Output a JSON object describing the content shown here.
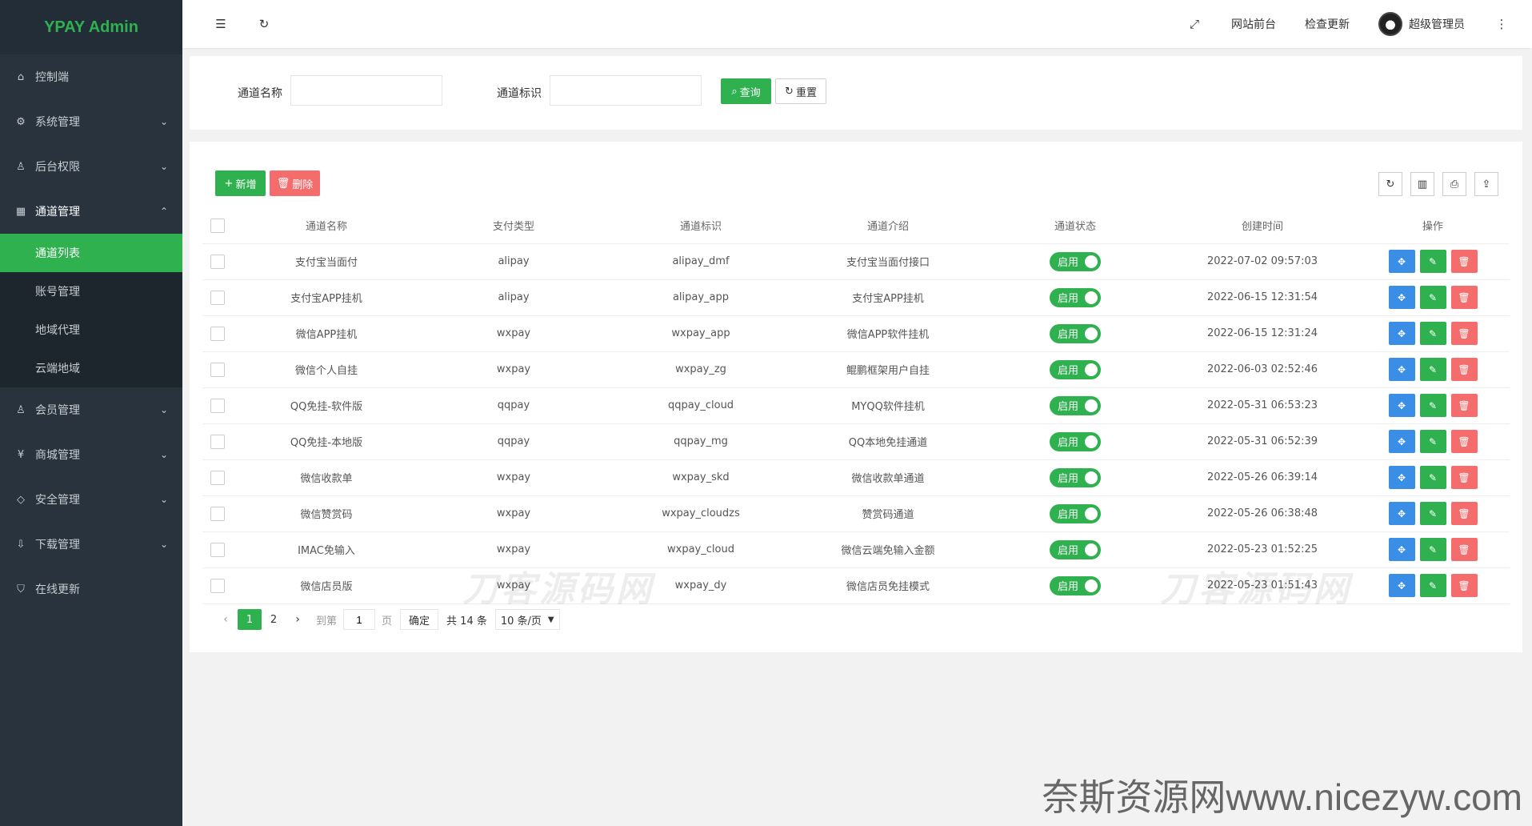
{
  "app": {
    "title": "YPAY Admin"
  },
  "sidebar": {
    "items": [
      {
        "label": "控制端",
        "icon": "home-icon"
      },
      {
        "label": "系统管理",
        "icon": "gear-icon"
      },
      {
        "label": "后台权限",
        "icon": "user-icon"
      },
      {
        "label": "通道管理",
        "icon": "apps-icon"
      },
      {
        "label": "会员管理",
        "icon": "user-icon"
      },
      {
        "label": "商城管理",
        "icon": "yen-icon"
      },
      {
        "label": "安全管理",
        "icon": "diamond-icon"
      },
      {
        "label": "下载管理",
        "icon": "download-icon"
      },
      {
        "label": "在线更新",
        "icon": "shield-check-icon"
      }
    ],
    "submenu": [
      "通道列表",
      "账号管理",
      "地域代理",
      "云端地域"
    ]
  },
  "header": {
    "site_front": "网站前台",
    "check_update": "检查更新",
    "user_name": "超级管理员"
  },
  "search": {
    "channel_name_label": "通道名称",
    "channel_name_value": "",
    "channel_id_label": "通道标识",
    "channel_id_value": "",
    "query_label": "查询",
    "reset_label": "重置"
  },
  "toolbar": {
    "add_label": "新增",
    "delete_label": "删除"
  },
  "table": {
    "columns": [
      "通道名称",
      "支付类型",
      "通道标识",
      "通道介绍",
      "通道状态",
      "创建时间",
      "操作"
    ],
    "rows": [
      {
        "name": "支付宝当面付",
        "pay_type": "alipay",
        "code": "alipay_dmf",
        "intro": "支付宝当面付接口",
        "status": "启用",
        "created": "2022-07-02 09:57:03"
      },
      {
        "name": "支付宝APP挂机",
        "pay_type": "alipay",
        "code": "alipay_app",
        "intro": "支付宝APP挂机",
        "status": "启用",
        "created": "2022-06-15 12:31:54"
      },
      {
        "name": "微信APP挂机",
        "pay_type": "wxpay",
        "code": "wxpay_app",
        "intro": "微信APP软件挂机",
        "status": "启用",
        "created": "2022-06-15 12:31:24"
      },
      {
        "name": "微信个人自挂",
        "pay_type": "wxpay",
        "code": "wxpay_zg",
        "intro": "鲲鹏框架用户自挂",
        "status": "启用",
        "created": "2022-06-03 02:52:46"
      },
      {
        "name": "QQ免挂-软件版",
        "pay_type": "qqpay",
        "code": "qqpay_cloud",
        "intro": "MYQQ软件挂机",
        "status": "启用",
        "created": "2022-05-31 06:53:23"
      },
      {
        "name": "QQ免挂-本地版",
        "pay_type": "qqpay",
        "code": "qqpay_mg",
        "intro": "QQ本地免挂通道",
        "status": "启用",
        "created": "2022-05-31 06:52:39"
      },
      {
        "name": "微信收款单",
        "pay_type": "wxpay",
        "code": "wxpay_skd",
        "intro": "微信收款单通道",
        "status": "启用",
        "created": "2022-05-26 06:39:14"
      },
      {
        "name": "微信赞赏码",
        "pay_type": "wxpay",
        "code": "wxpay_cloudzs",
        "intro": "赞赏码通道",
        "status": "启用",
        "created": "2022-05-26 06:38:48"
      },
      {
        "name": "IMAC免输入",
        "pay_type": "wxpay",
        "code": "wxpay_cloud",
        "intro": "微信云端免输入金额",
        "status": "启用",
        "created": "2022-05-23 01:52:25"
      },
      {
        "name": "微信店员版",
        "pay_type": "wxpay",
        "code": "wxpay_dy",
        "intro": "微信店员免挂模式",
        "status": "启用",
        "created": "2022-05-23 01:51:43"
      }
    ]
  },
  "pagination": {
    "pages": [
      "1",
      "2"
    ],
    "current": "1",
    "goto_label": "到第",
    "goto_value": "1",
    "page_unit": "页",
    "confirm_label": "确定",
    "total_text": "共 14 条",
    "page_size": "10 条/页"
  },
  "watermarks": {
    "logo_text": "刀客源码网",
    "bottom_text": "奈斯资源网www.nicezyw.com"
  },
  "colors": {
    "primary": "#2fb14f",
    "sidebar": "#28333e",
    "danger": "#f56c6c",
    "info": "#3a8ee6"
  }
}
